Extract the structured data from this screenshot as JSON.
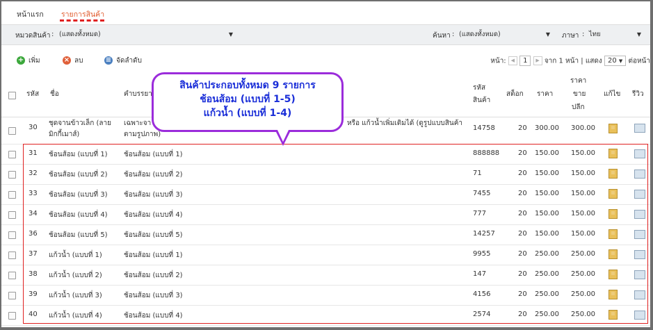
{
  "tabs": [
    "หน้าแรก",
    "รายการสินค้า"
  ],
  "filters": {
    "category_label": "หมวดสินค้า",
    "category_value": "(แสดงทั้งหมด)",
    "search_label": "ค้นหา",
    "search_value": "(แสดงทั้งหมด)",
    "language_label": "ภาษา",
    "language_value": "ไทย"
  },
  "toolbar": {
    "add_label": "เพิ่ม",
    "delete_label": "ลบ",
    "sort_label": "จัดลำดับ",
    "page_label": "หน้า:",
    "page_value": "1",
    "page_of": "จาก 1 หน้า | แสดง",
    "per_page": "20",
    "per_page_suffix": "ต่อหน้า"
  },
  "headers": {
    "id": "รหัส",
    "name": "ชื่อ",
    "desc": "คำบรรยาย",
    "code_1": "รหัส",
    "code_2": "สินค้า",
    "stock": "สต็อก",
    "price": "ราคา",
    "sale_1": "ราคา",
    "sale_2": "ขาย",
    "sale_3": "ปลีก",
    "edit": "แก้ไข",
    "review": "รีวิว"
  },
  "rows": [
    {
      "id": "30",
      "name_1": "ชุดจานข้าวเล็ก (ลาย",
      "name_2": "มิกกี้เมาส์)",
      "desc_1": "เฉพาะจา",
      "desc_tail": "หรือ แก้วน้ำเพิ่มเติมได้ (ดูรูปแบบสินค้า",
      "desc_2": "ตามรูปภาพ)",
      "code": "14758",
      "stock": "20",
      "price": "300.00",
      "sale": "300.00"
    },
    {
      "id": "31",
      "name_1": "ช้อนส้อม (แบบที่ 1)",
      "desc_1": "ช้อนส้อม (แบบที่ 1)",
      "code": "888888",
      "stock": "20",
      "price": "150.00",
      "sale": "150.00"
    },
    {
      "id": "32",
      "name_1": "ช้อนส้อม (แบบที่ 2)",
      "desc_1": "ช้อนส้อม (แบบที่ 2)",
      "code": "71",
      "stock": "20",
      "price": "150.00",
      "sale": "150.00"
    },
    {
      "id": "33",
      "name_1": "ช้อนส้อม (แบบที่ 3)",
      "desc_1": "ช้อนส้อม (แบบที่ 3)",
      "code": "7455",
      "stock": "20",
      "price": "150.00",
      "sale": "150.00"
    },
    {
      "id": "34",
      "name_1": "ช้อนส้อม (แบบที่ 4)",
      "desc_1": "ช้อนส้อม (แบบที่ 4)",
      "code": "777",
      "stock": "20",
      "price": "150.00",
      "sale": "150.00"
    },
    {
      "id": "36",
      "name_1": "ช้อนส้อม (แบบที่ 5)",
      "desc_1": "ช้อนส้อม (แบบที่ 5)",
      "code": "14257",
      "stock": "20",
      "price": "150.00",
      "sale": "150.00"
    },
    {
      "id": "37",
      "name_1": "แก้วน้ำ (แบบที่ 1)",
      "desc_1": "ช้อนส้อม (แบบที่ 1)",
      "code": "9955",
      "stock": "20",
      "price": "250.00",
      "sale": "250.00"
    },
    {
      "id": "38",
      "name_1": "แก้วน้ำ (แบบที่ 2)",
      "desc_1": "ช้อนส้อม (แบบที่ 2)",
      "code": "147",
      "stock": "20",
      "price": "250.00",
      "sale": "250.00"
    },
    {
      "id": "39",
      "name_1": "แก้วน้ำ (แบบที่ 3)",
      "desc_1": "ช้อนส้อม (แบบที่ 3)",
      "code": "4156",
      "stock": "20",
      "price": "250.00",
      "sale": "250.00"
    },
    {
      "id": "40",
      "name_1": "แก้วน้ำ (แบบที่ 4)",
      "desc_1": "ช้อนส้อม (แบบที่ 4)",
      "code": "2574",
      "stock": "20",
      "price": "250.00",
      "sale": "250.00"
    }
  ],
  "callout": {
    "line1": "สินค้าประกอบทั้งหมด 9 รายการ",
    "line2": "ช้อนส้อม (แบบที่ 1-5)",
    "line3": "แก้วน้ำ (แบบที่ 1-4)"
  },
  "colors": {
    "accent_tab": "#e05a2b",
    "annotation_border": "#e02020",
    "callout_border": "#9b2cdb",
    "callout_text": "#1a2ed8"
  }
}
